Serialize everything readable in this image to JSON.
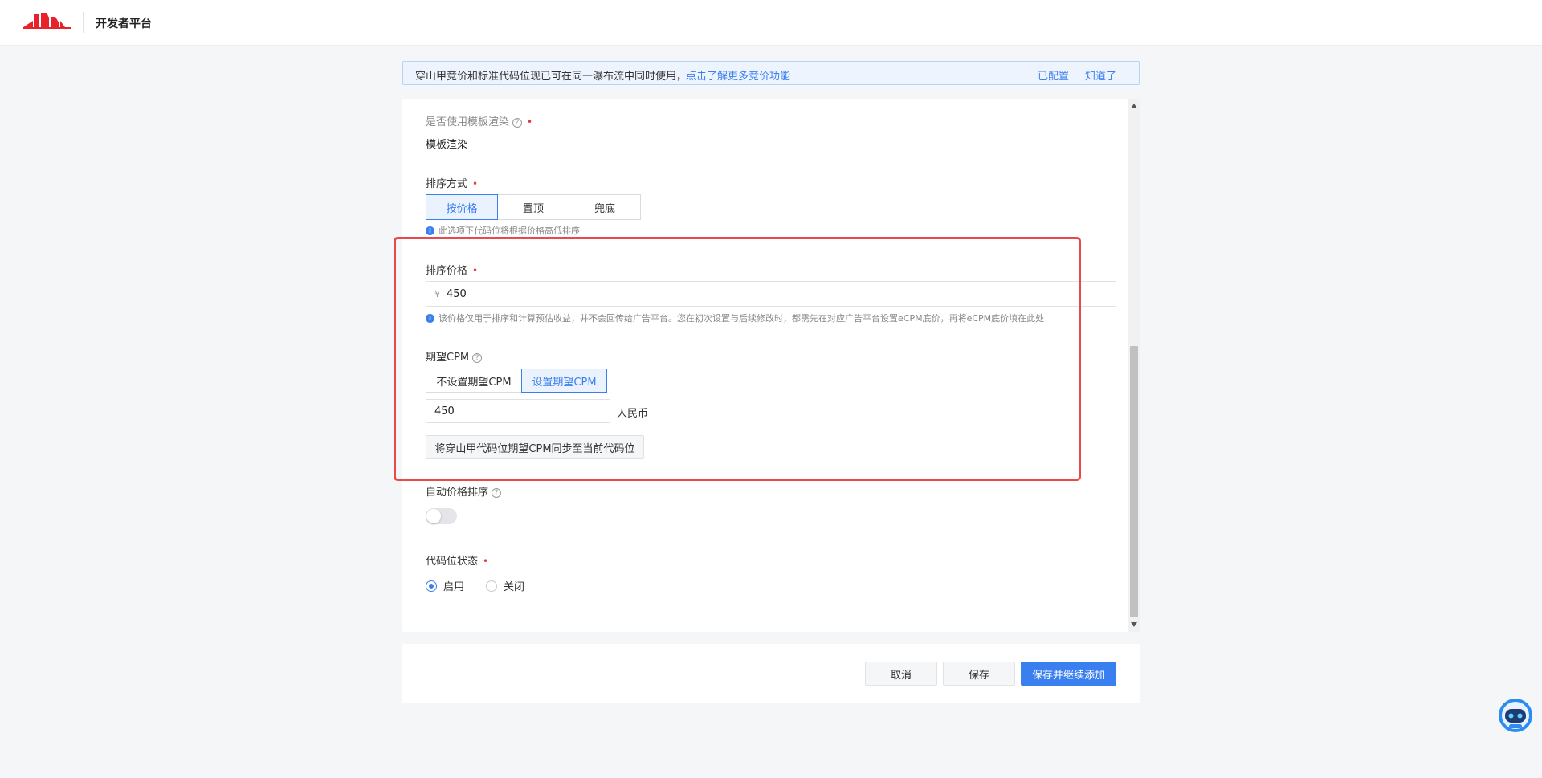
{
  "header": {
    "title": "开发者平台",
    "logo_icon": "brand-logo-icon",
    "brand_color": "#e8222a"
  },
  "notice": {
    "text": "穿山甲竞价和标准代码位现已可在同一瀑布流中同时使用，",
    "link": "点击了解更多竞价功能",
    "configured": "已配置",
    "got_it": "知道了"
  },
  "form": {
    "template_render": {
      "label": "是否使用模板渲染",
      "value": "模板渲染",
      "required": "•"
    },
    "sort_method": {
      "label": "排序方式",
      "required": "•",
      "options": [
        "按价格",
        "置顶",
        "兜底"
      ],
      "selected": "按价格",
      "hint": "此选项下代码位将根据价格高低排序"
    },
    "sort_price": {
      "label": "排序价格",
      "required": "•",
      "prefix": "¥",
      "value": "450",
      "hint": "该价格仅用于排序和计算预估收益，并不会回传给广告平台。您在初次设置与后续修改时，都需先在对应广告平台设置eCPM底价，再将eCPM底价填在此处"
    },
    "expected_cpm": {
      "label": "期望CPM",
      "options": [
        "不设置期望CPM",
        "设置期望CPM"
      ],
      "selected": "设置期望CPM",
      "value": "450",
      "unit": "人民币",
      "sync_button": "将穿山甲代码位期望CPM同步至当前代码位"
    },
    "auto_price_sort": {
      "label": "自动价格排序",
      "enabled": false
    },
    "status": {
      "label": "代码位状态",
      "required": "•",
      "options": [
        "启用",
        "关闭"
      ],
      "selected": "启用"
    }
  },
  "footer": {
    "cancel": "取消",
    "save": "保存",
    "save_continue": "保存并继续添加"
  },
  "assistant": {
    "icon": "robot-assistant-icon"
  },
  "colors": {
    "accent": "#3a7ff0",
    "highlight": "#e8494a",
    "required": "#e23c3c"
  }
}
